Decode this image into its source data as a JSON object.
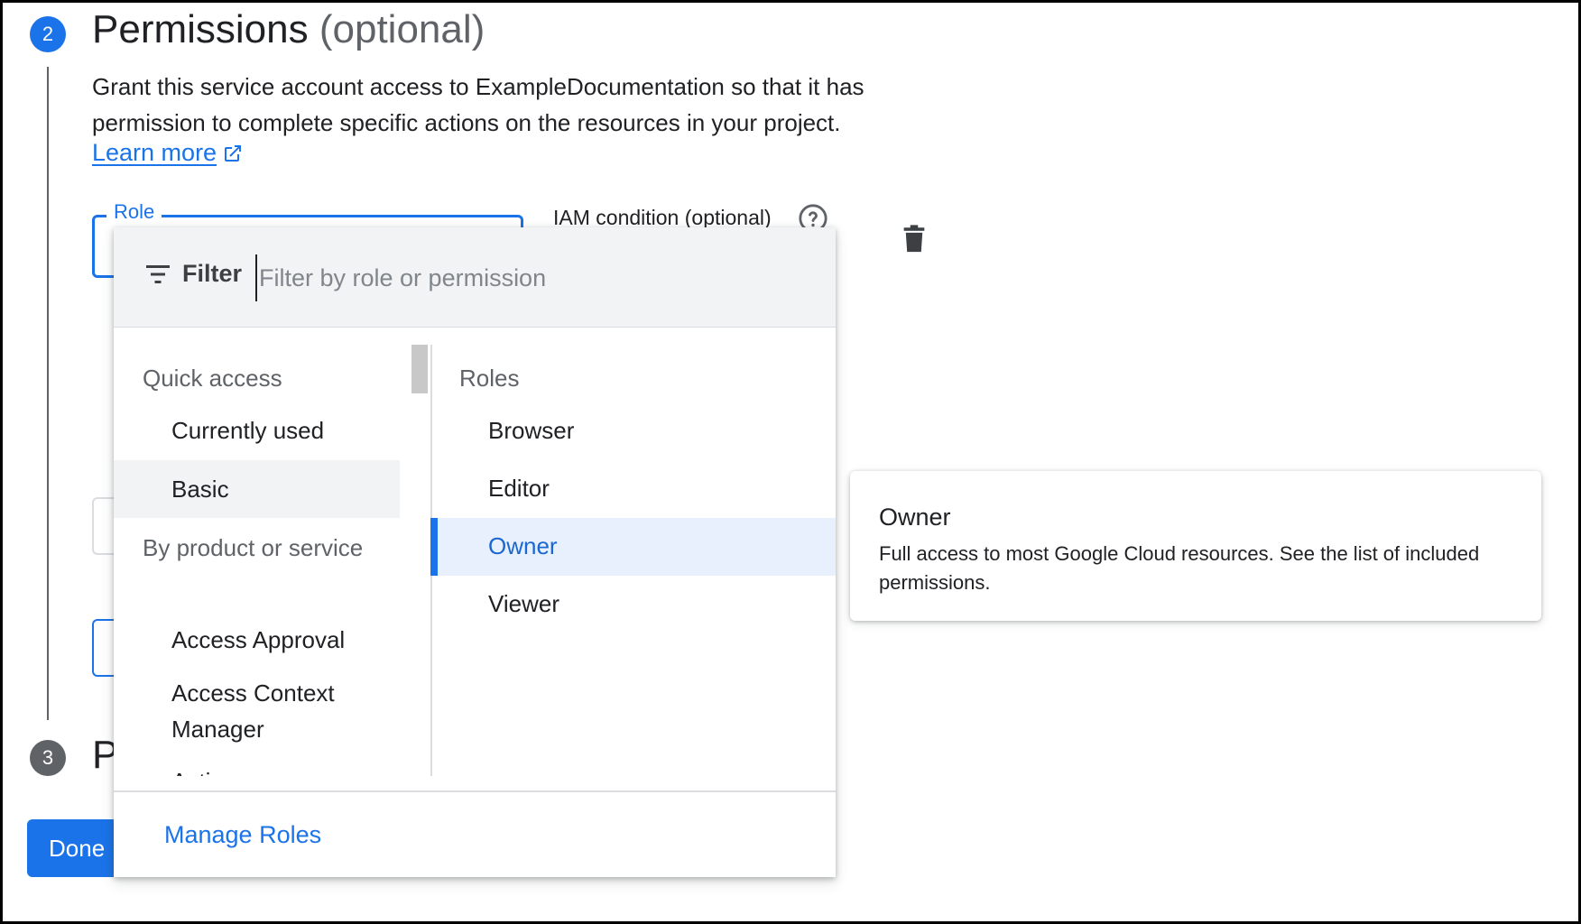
{
  "step2": {
    "number": "2",
    "title": "Permissions",
    "title_optional": "(optional)",
    "description": "Grant this service account access to ExampleDocumentation so that it has permission to complete specific actions on the resources in your project.",
    "learn_more": "Learn more"
  },
  "role_field": {
    "label": "Role",
    "iam_condition_label": "IAM condition (optional)"
  },
  "filter": {
    "label": "Filter",
    "placeholder": "Filter by role or permission"
  },
  "left_column": {
    "quick_access_heading": "Quick access",
    "quick_access_items": [
      "Currently used",
      "Basic"
    ],
    "by_product_heading": "By product or service",
    "product_items": [
      "Access Approval",
      "Access Context Manager",
      "Actions"
    ]
  },
  "right_column": {
    "heading": "Roles",
    "roles": [
      "Browser",
      "Editor",
      "Owner",
      "Viewer"
    ],
    "selected": "Owner"
  },
  "footer": {
    "manage_roles": "Manage Roles"
  },
  "role_card": {
    "title": "Owner",
    "description": "Full access to most Google Cloud resources. See the list of included permissions."
  },
  "step3": {
    "number": "3",
    "title_visible": "P"
  },
  "done_button": "Done",
  "colors": {
    "accent": "#1a73e8",
    "selected_bg": "#e8f0fe",
    "filter_bg": "#f1f3f4"
  }
}
